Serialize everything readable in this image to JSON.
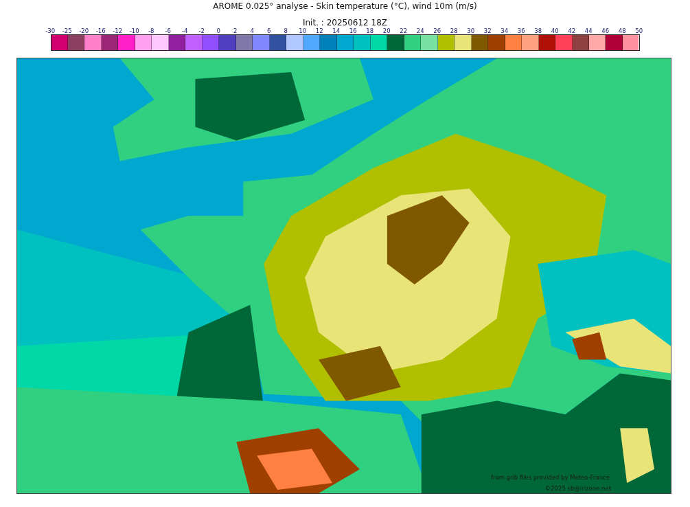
{
  "title": "AROME 0.025° analyse - Skin temperature (°C), wind 10m (m/s)",
  "subtitle": "Init. : 20250612 18Z",
  "colorbar": {
    "ticks": [
      "-30",
      "-25",
      "-20",
      "-16",
      "-12",
      "-10",
      "-8",
      "-6",
      "-4",
      "-2",
      "0",
      "2",
      "4",
      "6",
      "8",
      "10",
      "12",
      "14",
      "16",
      "18",
      "20",
      "22",
      "24",
      "26",
      "28",
      "30",
      "32",
      "34",
      "36",
      "38",
      "40",
      "42",
      "44",
      "46",
      "48",
      "50"
    ],
    "swatches": [
      {
        "color": "#d0006f"
      },
      {
        "color": "#8b4060"
      },
      {
        "color": "#ff80c8"
      },
      {
        "color": "#9b2678"
      },
      {
        "color": "#ff20c8"
      },
      {
        "color": "#ffa0f0"
      },
      {
        "color": "#ffc8ff"
      },
      {
        "color": "#9020a0"
      },
      {
        "color": "#c060ff"
      },
      {
        "color": "#9050ff"
      },
      {
        "color": "#5040c0"
      },
      {
        "color": "#8078a8"
      },
      {
        "color": "#8088ff"
      },
      {
        "color": "#3050a0"
      },
      {
        "color": "#b0c8ff"
      },
      {
        "color": "#50a8ff"
      },
      {
        "color": "#0080b8"
      },
      {
        "color": "#00a8d0"
      },
      {
        "color": "#00c0c0"
      },
      {
        "color": "#00d8a8"
      },
      {
        "color": "#006838"
      },
      {
        "color": "#30d080"
      },
      {
        "color": "#78e0a0"
      },
      {
        "color": "#b0c000"
      },
      {
        "color": "#e8e478"
      },
      {
        "color": "#805800"
      },
      {
        "color": "#a04000"
      },
      {
        "color": "#ff8040"
      },
      {
        "color": "#ffa080"
      },
      {
        "color": "#b01008"
      },
      {
        "color": "#ff4058"
      },
      {
        "color": "#904040"
      },
      {
        "color": "#ffa8a8"
      },
      {
        "color": "#b00038"
      },
      {
        "color": "#ff90a0"
      }
    ]
  },
  "map": {
    "credits": [
      "from grib files provided by Meteo-France",
      "©2025 sb@irizone.net"
    ]
  }
}
